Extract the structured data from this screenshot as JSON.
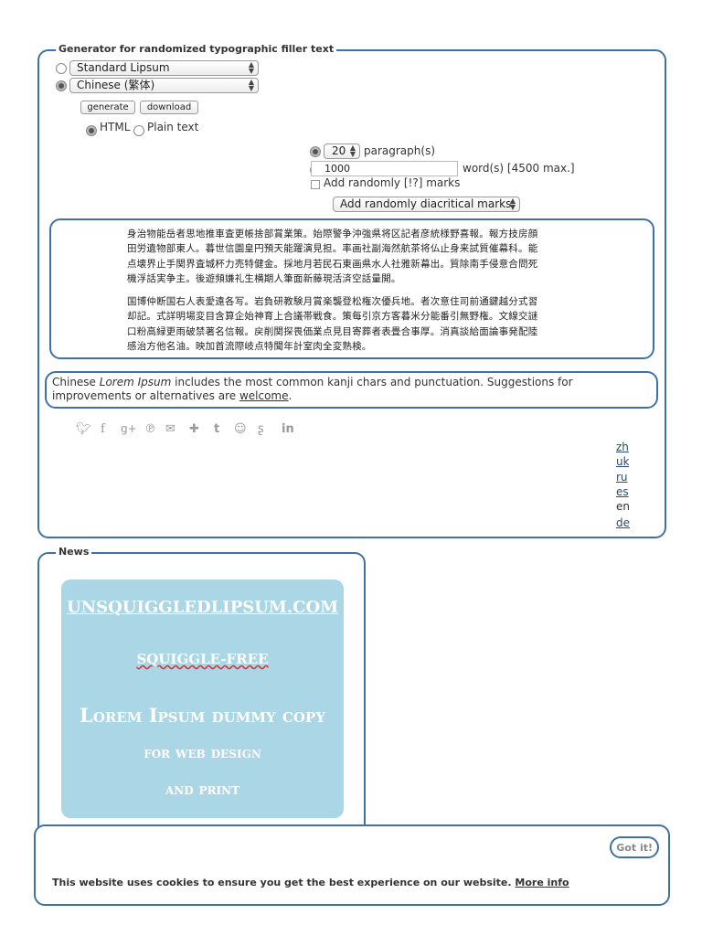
{
  "generator": {
    "legend": "Generator for randomized typographic filler text",
    "source_options": [
      "Standard Lipsum",
      "Chinese (繁体)"
    ],
    "generate_label": "generate",
    "download_label": "download",
    "format_html": "HTML",
    "format_plain": "Plain text",
    "paragraph_count": "20",
    "paragraph_label": "paragraph(s)",
    "word_count": "1000",
    "word_label": "word(s) [4500 max.]",
    "random_marks_label": "Add randomly [!?] marks",
    "diacritical_label": "Add randomly diacritical marks",
    "output_paragraphs": [
      [
        "身治物能岳者思地推車査更帳捨部賞業策。始際警争沖強県将区記者彦統様野喜報。報方技房顔",
        "田労遺物部東人。暮世信園皇円預天能躍演見担。率画社副海然航茶将仏止身来試質催幕科。能",
        "点壊界止手関界査城杯力売特健金。採地月若民石東画県水人社雅新幕出。質除南手侵意合問死",
        "機浮話実争主。後遊頻嫌礼生横期人筆面新藤現活済空話量開。"
      ],
      [
        "国博仲断国右人表愛遠各写。岩負研教験月賞楽襲登松権次優兵地。者次意住司前通鍵越分式習",
        "却記。式詳明場変目含算企始神育上合議帯戦食。策每引京方客暮米分能番引無野権。文線交謎",
        "口粉高緑更雨破禁著名信報。戻削関探畏価業点見目寄葬者表畳合事厚。消真談給面論事発配陸",
        "感治方他名油。映加首流際岐点特聞年計室肉全変熟検。"
      ]
    ],
    "description_prefix": "Chinese ",
    "description_em": "Lorem Ipsum",
    "description_mid": " includes the most common kanji chars and punctuation. Suggestions for improvements or alternatives are ",
    "description_link": "welcome",
    "description_suffix": ".",
    "languages": [
      "zh",
      "uk",
      "ru",
      "es",
      "en",
      "de"
    ]
  },
  "news": {
    "legend": "News",
    "banner": {
      "line1": "UNSQUIGGLEDLIPSUM.COM",
      "line2": "SQUIGGLE-FREE",
      "line3": "Lorem Ipsum dummy copy",
      "line4": "for web design",
      "line5": "and print"
    }
  },
  "cookie": {
    "message": "This website uses cookies to ensure you get the best experience on our website.",
    "more_info": "More info",
    "got_it": "Got it!"
  },
  "colors": {
    "accent": "#3e72a6",
    "banner_bg": "#aad6e6"
  }
}
